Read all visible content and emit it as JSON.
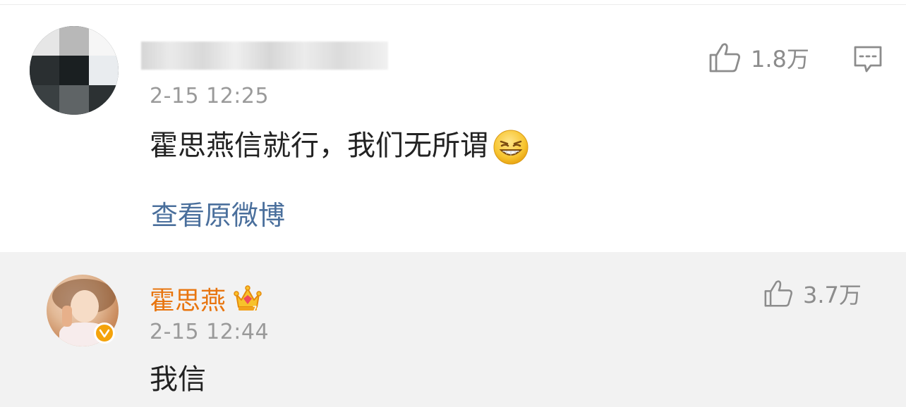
{
  "comments": [
    {
      "username_redacted": true,
      "time": "2-15 12:25",
      "text": "霍思燕信就行，我们无所谓",
      "emoji": "grin-squint-emoji",
      "likes": "1.8万",
      "view_original": "查看原微博"
    },
    {
      "username": "霍思燕",
      "badge": "crown-icon",
      "verified": true,
      "time": "2-15 12:44",
      "text": "我信",
      "likes": "3.7万"
    }
  ],
  "colors": {
    "username_orange": "#e8750f",
    "link_blue": "#4a6f9c",
    "meta_grey": "#9a9a9a",
    "reply_bg": "#f2f2f2"
  }
}
